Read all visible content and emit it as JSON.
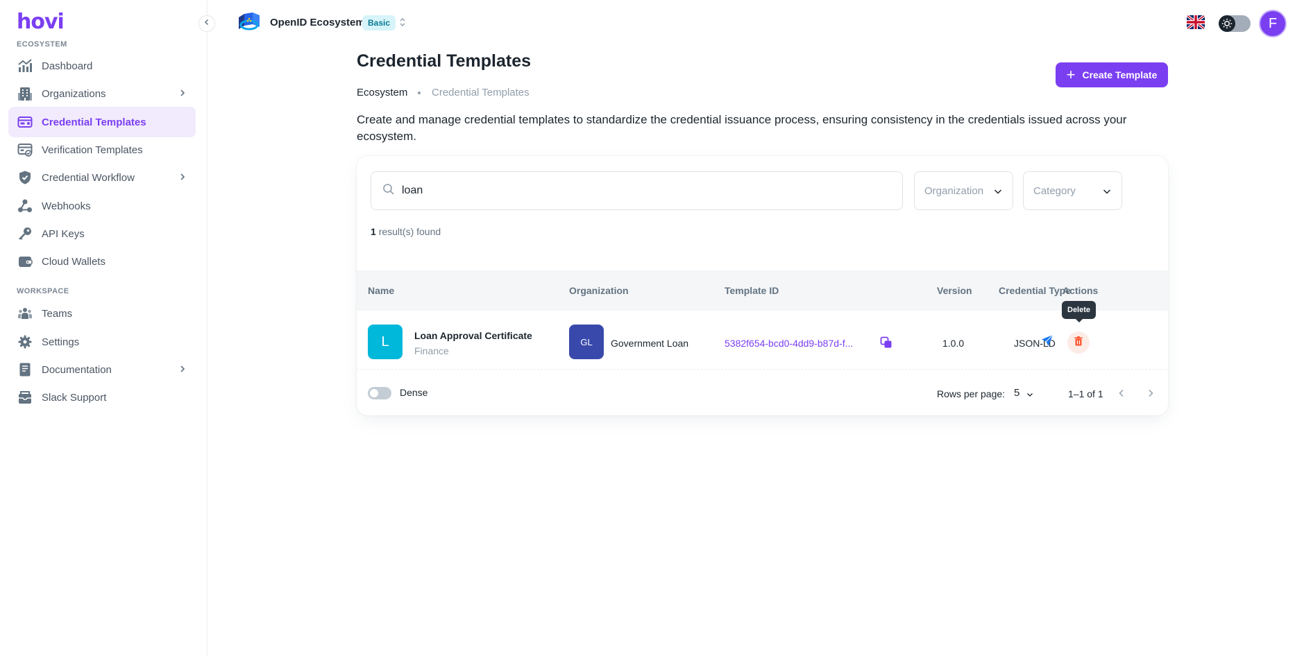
{
  "brand": {
    "logo_text": "hovi"
  },
  "sidebar": {
    "ecosystem_label": "ECOSYSTEM",
    "workspace_label": "WORKSPACE",
    "items": [
      {
        "label": "Dashboard",
        "icon": "chart-icon"
      },
      {
        "label": "Organizations",
        "icon": "building-icon"
      },
      {
        "label": "Credential Templates",
        "icon": "credential-card-icon",
        "active": true
      },
      {
        "label": "Verification Templates",
        "icon": "verification-card-icon"
      },
      {
        "label": "Credential Workflow",
        "icon": "shield-icon"
      },
      {
        "label": "Webhooks",
        "icon": "webhook-icon"
      },
      {
        "label": "API Keys",
        "icon": "key-icon"
      },
      {
        "label": "Cloud Wallets",
        "icon": "wallet-icon"
      },
      {
        "label": "Teams",
        "icon": "team-icon"
      },
      {
        "label": "Settings",
        "icon": "gear-icon"
      },
      {
        "label": "Documentation",
        "icon": "document-icon"
      },
      {
        "label": "Slack Support",
        "icon": "support-icon"
      }
    ]
  },
  "topbar": {
    "ecosystem_name": "OpenID Ecosystem",
    "plan_badge": "Basic",
    "avatar_initial": "F"
  },
  "header": {
    "title": "Credential Templates",
    "create_button": "Create Template",
    "breadcrumb": [
      "Ecosystem",
      "Credential Templates"
    ],
    "description": "Create and manage credential templates to standardize the credential issuance process, ensuring consistency in the credentials issued across your ecosystem."
  },
  "filters": {
    "search_value": "loan",
    "organization_placeholder": "Organization",
    "category_placeholder": "Category",
    "result_count": "1",
    "result_text": "result(s) found"
  },
  "table": {
    "columns": [
      "Name",
      "Organization",
      "Template ID",
      "Version",
      "Credential Type",
      "Actions"
    ],
    "rows": [
      {
        "avatar_letter": "L",
        "name": "Loan Approval Certificate",
        "category": "Finance",
        "org_initials": "GL",
        "organization": "Government Loan",
        "template_id": "5382f654-bcd0-4dd9-b87d-f...",
        "version": "1.0.0",
        "credential_type": "JSON-LD"
      }
    ],
    "delete_tooltip": "Delete"
  },
  "pagination": {
    "dense_label": "Dense",
    "rows_per_page_label": "Rows per page:",
    "rows_per_page_value": "5",
    "range": "1–1 of 1"
  },
  "colors": {
    "primary": "#7b3ff2",
    "badge_bg": "#d6f4f9",
    "name_avatar": "#00b8d9",
    "org_avatar": "#3949ab",
    "delete": "#ff5630"
  }
}
